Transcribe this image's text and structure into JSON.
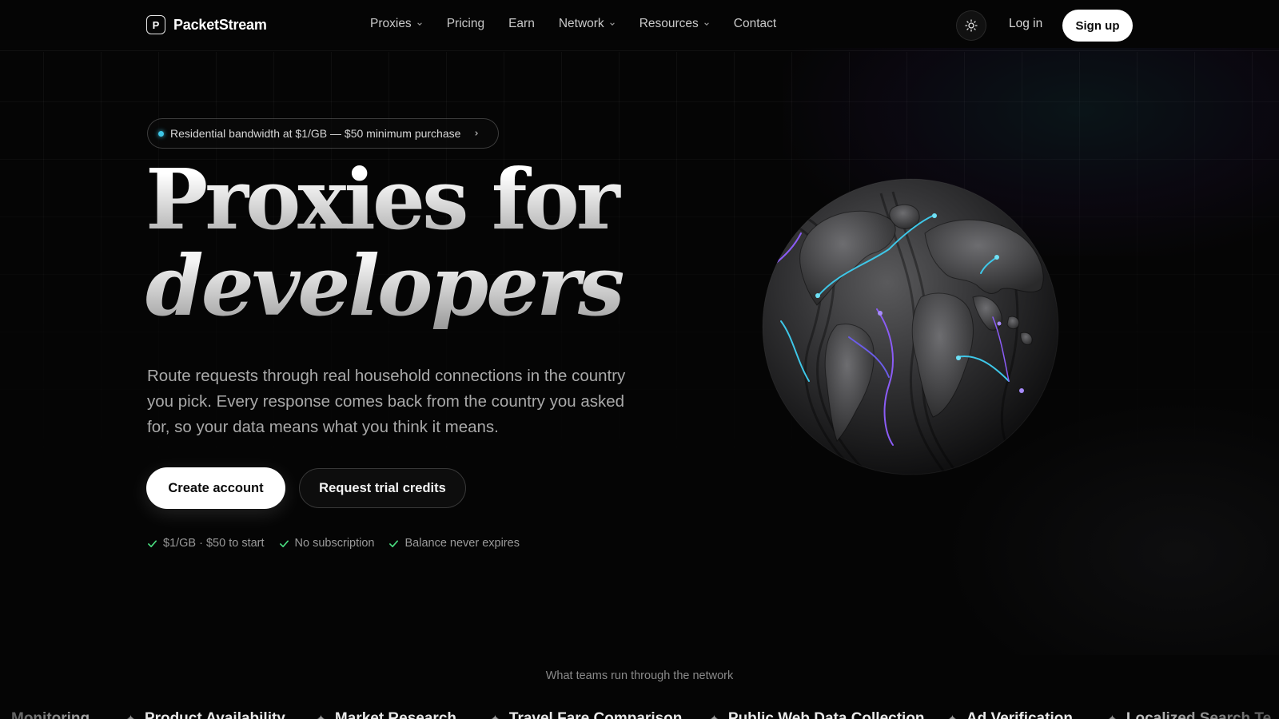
{
  "brand": {
    "name": "PacketStream",
    "logo_letter": "P"
  },
  "nav": {
    "items": [
      {
        "label": "Proxies",
        "has_dropdown": true
      },
      {
        "label": "Pricing",
        "has_dropdown": false
      },
      {
        "label": "Earn",
        "has_dropdown": false
      },
      {
        "label": "Network",
        "has_dropdown": true
      },
      {
        "label": "Resources",
        "has_dropdown": true
      },
      {
        "label": "Contact",
        "has_dropdown": false
      }
    ],
    "theme_icon": "sun-icon",
    "login_label": "Log in",
    "signup_label": "Sign up"
  },
  "hero": {
    "announcement": "Residential bandwidth at $1/GB — $50 minimum purchase",
    "headline_line1": "Proxies for",
    "headline_line2": "developers",
    "subtitle": "Route requests through real household connections in the country you pick. Every response comes back from the country you asked for, so your data means what you think it means.",
    "primary_cta": "Create account",
    "secondary_cta": "Request trial credits",
    "checks": [
      "$1/GB · $50 to start",
      "No subscription",
      "Balance never expires"
    ]
  },
  "teams": {
    "label": "What teams run through the network",
    "use_cases": [
      "Monitoring",
      "Product Availability",
      "Market Research",
      "Travel Fare Comparison",
      "Public Web Data Collection",
      "Ad Verification",
      "Localized Search Te"
    ]
  },
  "colors": {
    "background": "#050505",
    "accent_cyan": "#3ec7e8",
    "accent_purple": "#8b5cf6",
    "check_green": "#4ade80"
  }
}
